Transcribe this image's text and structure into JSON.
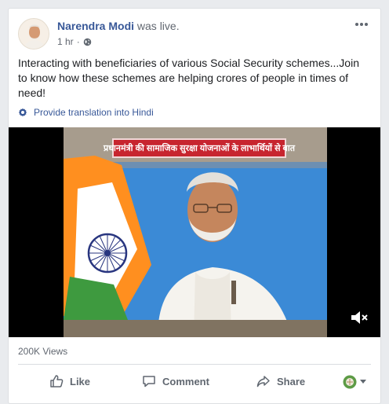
{
  "post": {
    "author_name": "Narendra Modi",
    "author_status": "was live.",
    "time": "1 hr",
    "privacy_icon": "globe-icon",
    "text": "Interacting with beneficiaries of various Social Security schemes...Join to know how these schemes are helping crores of people in times of need!",
    "translation_link": "Provide translation into Hindi"
  },
  "video": {
    "banner_text": "प्रधानमंत्री की सामाजिक सुरक्षा योजनाओं के लाभार्थियों से बात",
    "muted": true
  },
  "stats": {
    "views": "200K Views"
  },
  "actions": {
    "like": "Like",
    "comment": "Comment",
    "share": "Share"
  },
  "colors": {
    "link": "#385898",
    "secondary_text": "#616770",
    "banner": "#c7252f",
    "video_bg": "#3b8ad6"
  }
}
